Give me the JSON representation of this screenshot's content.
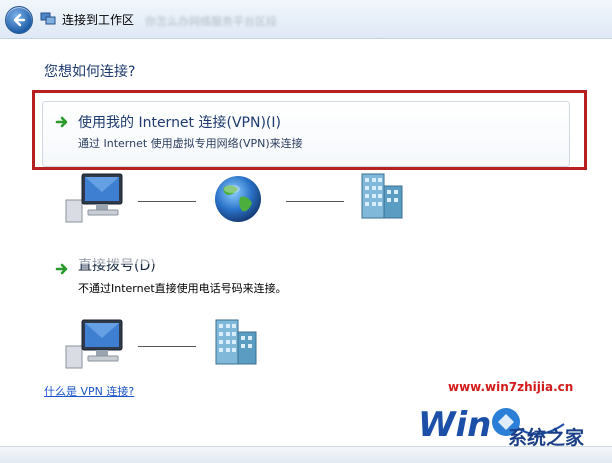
{
  "window": {
    "title": "连接到工作区",
    "blurred_title": "你怎么办网络服务平台区段"
  },
  "main": {
    "question": "您想如何连接?"
  },
  "options": [
    {
      "title": "使用我的 Internet 连接(VPN)(I)",
      "description": "通过 Internet 使用虚拟专用网络(VPN)来连接"
    },
    {
      "title": "直接拨号(D)",
      "description": "不通过Internet直接使用电话号码来连接。"
    }
  ],
  "help_link": "什么是 VPN 连接?",
  "watermark": {
    "url": "www.win7zhijia.cn",
    "brand": "系统之家",
    "logo_text": "Win"
  },
  "colors": {
    "accent_highlight": "#b72020",
    "link": "#1a55c8",
    "title_text": "#1e3a6e"
  },
  "icons": [
    "back-arrow-icon",
    "network-icon",
    "green-arrow-icon",
    "computer-icon",
    "globe-icon",
    "building-icon"
  ]
}
